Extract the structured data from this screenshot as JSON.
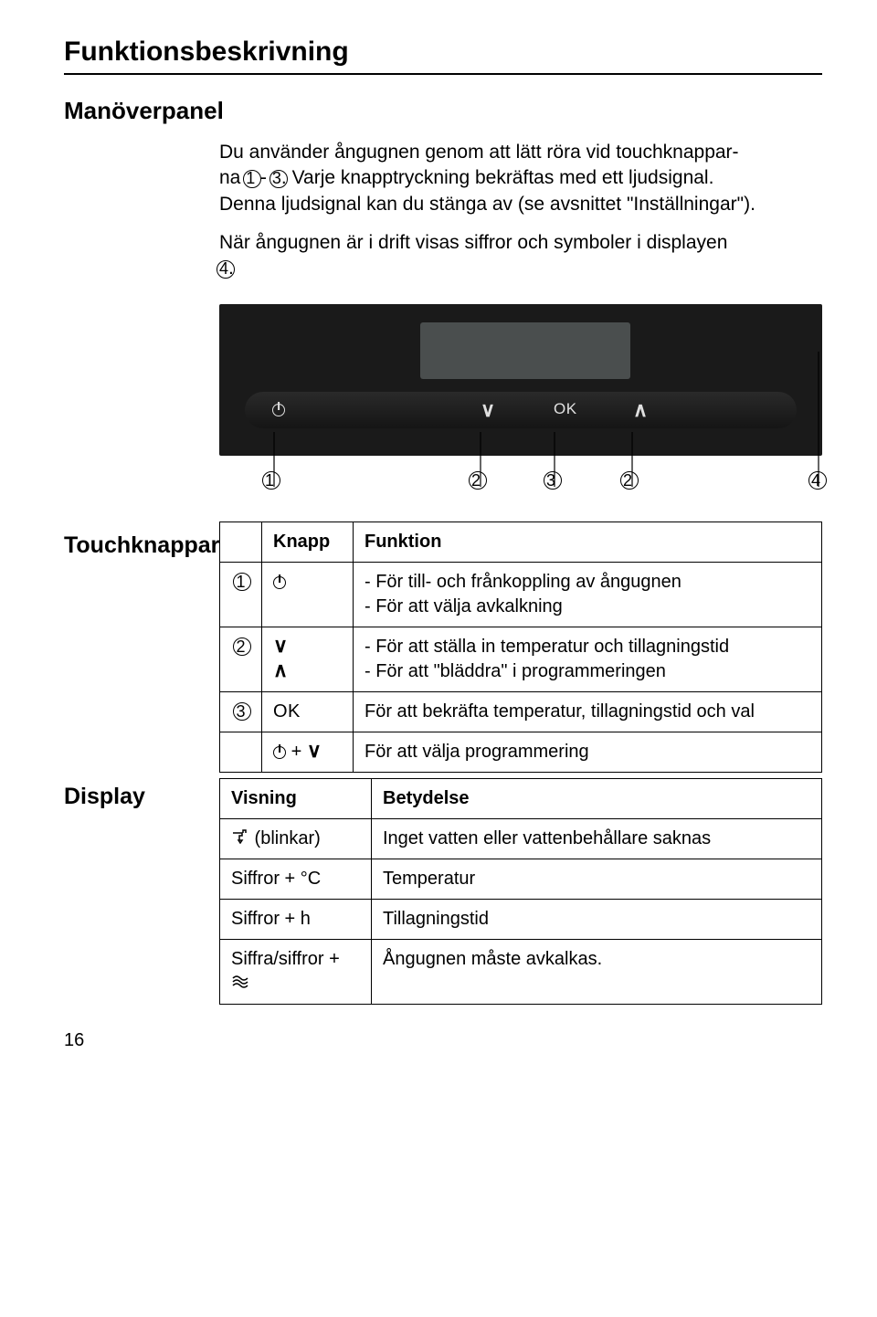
{
  "header": {
    "section_title": "Funktionsbeskrivning",
    "subheading": "Manöverpanel"
  },
  "intro": {
    "p1a": "Du använder ångugnen genom att lätt röra vid touchknappar-",
    "p1b": "na ",
    "p1c": " - ",
    "p1d": ". Varje knapptryckning bekräftas med ett ljudsignal.",
    "p2": "Denna ljudsignal kan du stänga av (se avsnittet \"Inställning­ar\").",
    "p3a": "När ångugnen är i drift visas siffror och symboler i displayen",
    "p3b": "."
  },
  "callout_refs": {
    "c1": "1",
    "c2": "2",
    "c3": "3",
    "c4": "4"
  },
  "panel": {
    "ok_label": "OK"
  },
  "touch": {
    "heading": "Touchknappar",
    "col_knapp": "Knapp",
    "col_funktion": "Funktion",
    "rows": [
      {
        "idx": "1",
        "key_type": "power",
        "desc": "- För till- och frånkoppling av ångugnen\n- För att välja avkalkning"
      },
      {
        "idx": "2",
        "key_type": "chev_pair",
        "desc": "- För att ställa in temperatur och tillagningstid\n- För att \"bläddra\" i programmeringen"
      },
      {
        "idx": "3",
        "key_type": "ok",
        "key_text": "OK",
        "desc": "För att bekräfta temperatur, tillagningstid och val"
      },
      {
        "idx": "",
        "key_type": "power_plus_down",
        "desc": "För att välja programmering"
      }
    ]
  },
  "display": {
    "heading": "Display",
    "col_visning": "Visning",
    "col_betydelse": "Betydelse",
    "rows": [
      {
        "vis_type": "faucet_blink",
        "vis_suffix": " (blinkar)",
        "mean": "Inget vatten eller vattenbehållare saknas"
      },
      {
        "vis_text": "Siffror + °C",
        "mean": "Temperatur"
      },
      {
        "vis_text": "Siffror + h",
        "mean": "Tillagningstid"
      },
      {
        "vis_type": "descale",
        "vis_prefix": "Siffra/siffror + ",
        "mean": "Ångugnen måste avkalkas."
      }
    ]
  },
  "page_number": "16"
}
